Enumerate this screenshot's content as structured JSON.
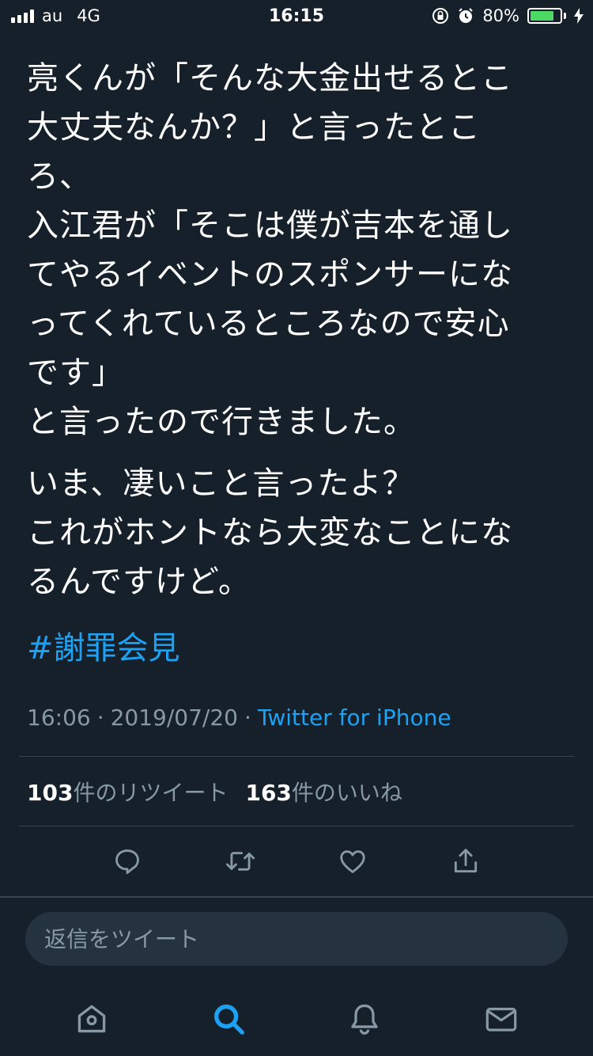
{
  "status_bar": {
    "carrier": "au",
    "network": "4G",
    "time": "16:15",
    "battery_percent_text": "80%",
    "battery_level": 0.8,
    "icons": [
      "signal-icon",
      "orientation-lock-icon",
      "alarm-icon",
      "battery-icon",
      "charging-bolt-icon"
    ]
  },
  "tweet": {
    "paragraph1": [
      "亮くんが「そんな大金出せるとこ",
      "大丈夫なんか？」と言ったとこ",
      "ろ、",
      "入江君が「そこは僕が吉本を通し",
      "てやるイベントのスポンサーにな",
      "ってくれているところなので安心",
      "です」",
      "と言ったので行きました。"
    ],
    "paragraph2": [
      "いま、凄いこと言ったよ？",
      "これがホントなら大変なことにな",
      "るんですけど。"
    ],
    "hashtag": "#謝罪会見",
    "time": "16:06",
    "separator": "·",
    "date": "2019/07/20",
    "source": "Twitter for iPhone",
    "retweet_count": "103",
    "retweet_label": "件のリツイート",
    "like_count": "163",
    "like_label": "件のいいね"
  },
  "actions": [
    "reply-icon",
    "retweet-icon",
    "like-icon",
    "share-icon"
  ],
  "reply_box": {
    "placeholder": "返信をツイート"
  },
  "tab_bar": [
    "home-icon",
    "search-icon",
    "notifications-icon",
    "messages-icon"
  ],
  "colors": {
    "background": "#15202b",
    "accent": "#1da1f2",
    "secondary_text": "#8899a6",
    "divider": "#38444d",
    "battery_fill": "#4cd964"
  }
}
